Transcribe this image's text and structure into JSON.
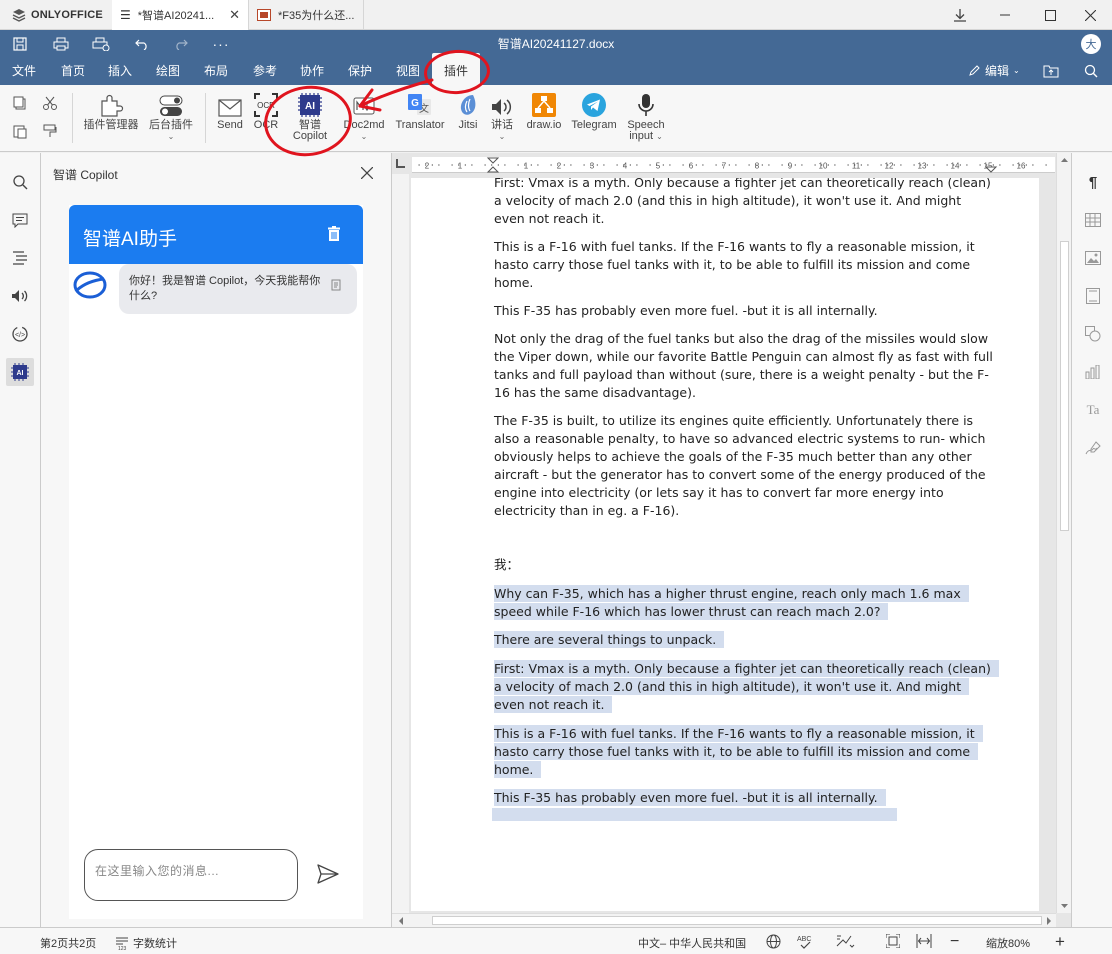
{
  "app": {
    "name": "ONLYOFFICE"
  },
  "tabs": [
    {
      "label": "*智谱AI20241..."
    },
    {
      "label": "*F35为什么还..."
    }
  ],
  "header": {
    "doc_title": "智谱AI20241127.docx",
    "avatar": "大",
    "edit_label": "编辑"
  },
  "menu": [
    "文件",
    "首页",
    "插入",
    "绘图",
    "布局",
    "参考",
    "协作",
    "保护",
    "视图",
    "插件"
  ],
  "toolbar": {
    "plugin_manager": "插件管理器",
    "bg_plugins": "后台插件",
    "send": "Send",
    "ocr": "OCR",
    "copilot_line1": "智谱",
    "copilot_line2": "Copilot",
    "doc2md": "Doc2md",
    "translator": "Translator",
    "jitsi": "Jitsi",
    "speak": "讲话",
    "drawio": "draw.io",
    "telegram": "Telegram",
    "speech_line1": "Speech",
    "speech_line2": "input"
  },
  "panel": {
    "title": "智谱 Copilot",
    "chat_title": "智谱AI助手",
    "greeting": "你好！我是智谱 Copilot，今天我能帮你什么?",
    "input_placeholder": "在这里输入您的消息..."
  },
  "document": {
    "paragraphs": [
      "First: Vmax is a myth. Only because a fighter jet can theoretically reach (clean) a velocity of mach 2.0 (and this in high altitude), it won't use it. And might even not reach it.",
      "This is a F-16 with fuel tanks. If the F-16 wants to fly a reasonable mission, it hasto carry those fuel tanks with it, to be able to fulfill its mission and come home.",
      "This F-35 has probably even more fuel. -but it is all internally.",
      "Not only the drag of the fuel tanks but also the drag of the missiles would slow the Viper down, while our favorite Battle Penguin can almost fly as fast with full tanks and full payload than without (sure, there is a weight penalty - but the F-16 has the same disadvantage).",
      "The F-35 is built, to utilize its engines quite efficiently. Unfortunately there is also a reasonable penalty, to have so advanced electric systems to run- which obviously helps to achieve the goals of the F-35 much better than any other aircraft - but the generator has to convert some of the energy produced of the engine into electricity (or lets say it has to convert far more energy into electricity than in eg. a F-16).",
      "我：",
      "Why can F-35, which has a higher thrust engine, reach only mach 1.6 max speed while F-16 which has lower thrust can reach mach 2.0?",
      "There are several things to unpack.",
      "First: Vmax is a myth. Only because a fighter jet can theoretically reach (clean) a velocity of mach 2.0 (and this in high altitude), it won't use it. And might even not reach it.",
      "This is a F-16 with fuel tanks. If the F-16 wants to fly a reasonable mission, it hasto carry those fuel tanks with it, to be able to fulfill its mission and come home.",
      "This F-35 has probably even more fuel. -but it is all internally."
    ]
  },
  "statusbar": {
    "page_info": "第2页共2页",
    "word_count": "字数统计",
    "language": "中文– 中华人民共和国",
    "zoom": "缩放80%"
  },
  "colors": {
    "header": "#446995",
    "accent": "#1b7cf0",
    "annotation": "#e0141e",
    "selection": "#d3ddee"
  }
}
